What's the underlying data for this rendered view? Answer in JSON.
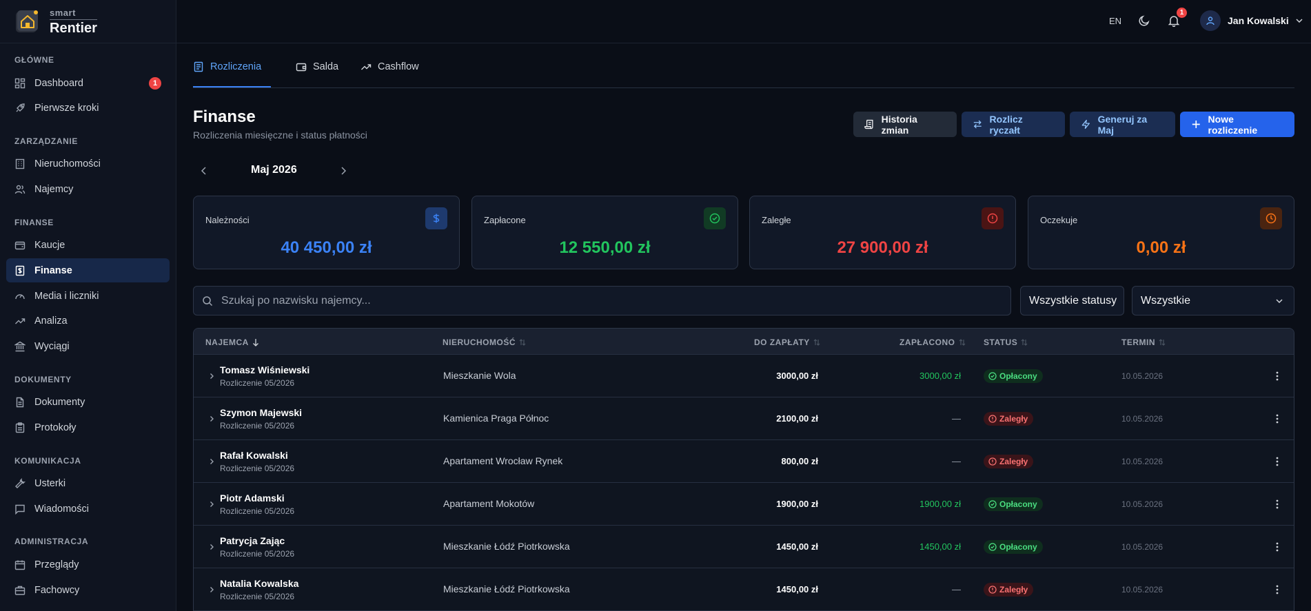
{
  "brand": {
    "small": "smart",
    "big": "Rentier"
  },
  "sidebar": {
    "sections": [
      {
        "title": "GŁÓWNE",
        "items": [
          {
            "label": "Dashboard",
            "icon": "dashboard-icon",
            "badge": "1"
          },
          {
            "label": "Pierwsze kroki",
            "icon": "rocket-icon"
          }
        ]
      },
      {
        "title": "ZARZĄDZANIE",
        "items": [
          {
            "label": "Nieruchomości",
            "icon": "building-icon"
          },
          {
            "label": "Najemcy",
            "icon": "users-icon"
          }
        ]
      },
      {
        "title": "FINANSE",
        "items": [
          {
            "label": "Kaucje",
            "icon": "wallet-icon"
          },
          {
            "label": "Finanse",
            "icon": "receipt-icon",
            "active": true
          },
          {
            "label": "Media i liczniki",
            "icon": "gauge-icon"
          },
          {
            "label": "Analiza",
            "icon": "trending-up-icon"
          },
          {
            "label": "Wyciągi",
            "icon": "bank-icon"
          }
        ]
      },
      {
        "title": "DOKUMENTY",
        "items": [
          {
            "label": "Dokumenty",
            "icon": "document-icon"
          },
          {
            "label": "Protokoły",
            "icon": "clipboard-icon"
          }
        ]
      },
      {
        "title": "KOMUNIKACJA",
        "items": [
          {
            "label": "Usterki",
            "icon": "wrench-icon"
          },
          {
            "label": "Wiadomości",
            "icon": "message-icon"
          }
        ]
      },
      {
        "title": "ADMINISTRACJA",
        "items": [
          {
            "label": "Przeglądy",
            "icon": "calendar-icon"
          },
          {
            "label": "Fachowcy",
            "icon": "briefcase-icon"
          }
        ]
      }
    ]
  },
  "topbar": {
    "lang": "EN",
    "notifications": "1",
    "user": "Jan Kowalski"
  },
  "tabs": [
    "Rozliczenia",
    "Salda",
    "Cashflow"
  ],
  "page": {
    "title": "Finanse",
    "subtitle": "Rozliczenia miesięczne i status płatności"
  },
  "actions": {
    "history": "Historia zmian",
    "lump": "Rozlicz ryczałt",
    "generate": "Generuj za Maj",
    "new": "Nowe rozliczenie"
  },
  "month": "Maj 2026",
  "cards": [
    {
      "label": "Należności",
      "value": "40 450,00 zł",
      "color": "#3b82f6",
      "icon": "dollar-icon",
      "icon_bg": "#1e3a6e"
    },
    {
      "label": "Zapłacone",
      "value": "12 550,00 zł",
      "color": "#22c55e",
      "icon": "check-circle-icon",
      "icon_bg": "#113b24"
    },
    {
      "label": "Zaległe",
      "value": "27 900,00 zł",
      "color": "#ef4444",
      "icon": "alert-circle-icon",
      "icon_bg": "#4a1414"
    },
    {
      "label": "Oczekuje",
      "value": "0,00 zł",
      "color": "#f97316",
      "icon": "clock-icon",
      "icon_bg": "#4a2410"
    }
  ],
  "filters": {
    "search_placeholder": "Szukaj po nazwisku najemcy...",
    "status": "Wszystkie statusy",
    "all": "Wszystkie"
  },
  "table": {
    "columns": [
      "NAJEMCA",
      "NIERUCHOMOŚĆ",
      "DO ZAPŁATY",
      "ZAPŁACONO",
      "STATUS",
      "TERMIN"
    ],
    "rows": [
      {
        "name": "Tomasz Wiśniewski",
        "sub": "Rozliczenie 05/2026",
        "property": "Mieszkanie Wola",
        "due": "3000,00 zł",
        "paid": "3000,00 zł",
        "status": "Opłacony",
        "state": "paid",
        "term": "10.05.2026"
      },
      {
        "name": "Szymon Majewski",
        "sub": "Rozliczenie 05/2026",
        "property": "Kamienica Praga Północ",
        "due": "2100,00 zł",
        "paid": "—",
        "status": "Zaległy",
        "state": "late",
        "term": "10.05.2026"
      },
      {
        "name": "Rafał Kowalski",
        "sub": "Rozliczenie 05/2026",
        "property": "Apartament Wrocław Rynek",
        "due": "800,00 zł",
        "paid": "—",
        "status": "Zaległy",
        "state": "late",
        "term": "10.05.2026"
      },
      {
        "name": "Piotr Adamski",
        "sub": "Rozliczenie 05/2026",
        "property": "Apartament Mokotów",
        "due": "1900,00 zł",
        "paid": "1900,00 zł",
        "status": "Opłacony",
        "state": "paid",
        "term": "10.05.2026"
      },
      {
        "name": "Patrycja Zając",
        "sub": "Rozliczenie 05/2026",
        "property": "Mieszkanie Łódź Piotrkowska",
        "due": "1450,00 zł",
        "paid": "1450,00 zł",
        "status": "Opłacony",
        "state": "paid",
        "term": "10.05.2026"
      },
      {
        "name": "Natalia Kowalska",
        "sub": "Rozliczenie 05/2026",
        "property": "Mieszkanie Łódź Piotrkowska",
        "due": "1450,00 zł",
        "paid": "—",
        "status": "Zaległy",
        "state": "late",
        "term": "10.05.2026"
      }
    ]
  }
}
